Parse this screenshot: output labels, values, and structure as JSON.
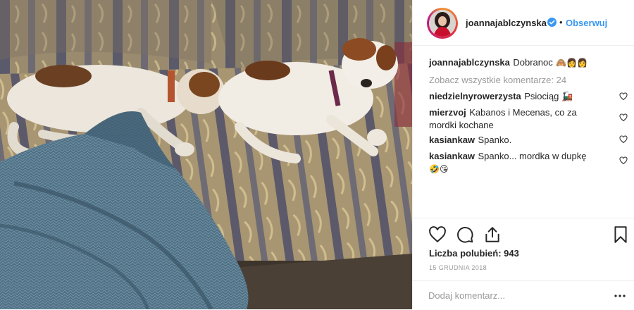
{
  "header": {
    "username": "joannajablczynska",
    "separator": "•",
    "follow_label": "Obserwuj"
  },
  "caption": {
    "user": "joannajablczynska",
    "text": "Dobranoc",
    "emoji": "🙈👩👩"
  },
  "view_all_comments": "Zobacz wszystkie komentarze: 24",
  "comments": [
    {
      "user": "niedzielnyrowerzysta",
      "text": "Psiociąg 🚂"
    },
    {
      "user": "mierzvoj",
      "text": "Kabanos i Mecenas, co za mordki kochane"
    },
    {
      "user": "kasiankaw",
      "text": "Spanko."
    },
    {
      "user": "kasiankaw",
      "text": "Spanko... mordka w dupkę",
      "emoji": "🤣😘"
    }
  ],
  "likes": "Liczba polubień: 943",
  "date": "15 GRUDNIA 2018",
  "add_comment": {
    "placeholder": "Dodaj komentarz..."
  },
  "colors": {
    "link": "#3897f0",
    "muted": "#999999",
    "text": "#262626",
    "verified": "#3897f0"
  },
  "icons": [
    "verified-badge-icon",
    "heart-icon",
    "comment-icon",
    "share-icon",
    "bookmark-icon",
    "more-icon"
  ]
}
